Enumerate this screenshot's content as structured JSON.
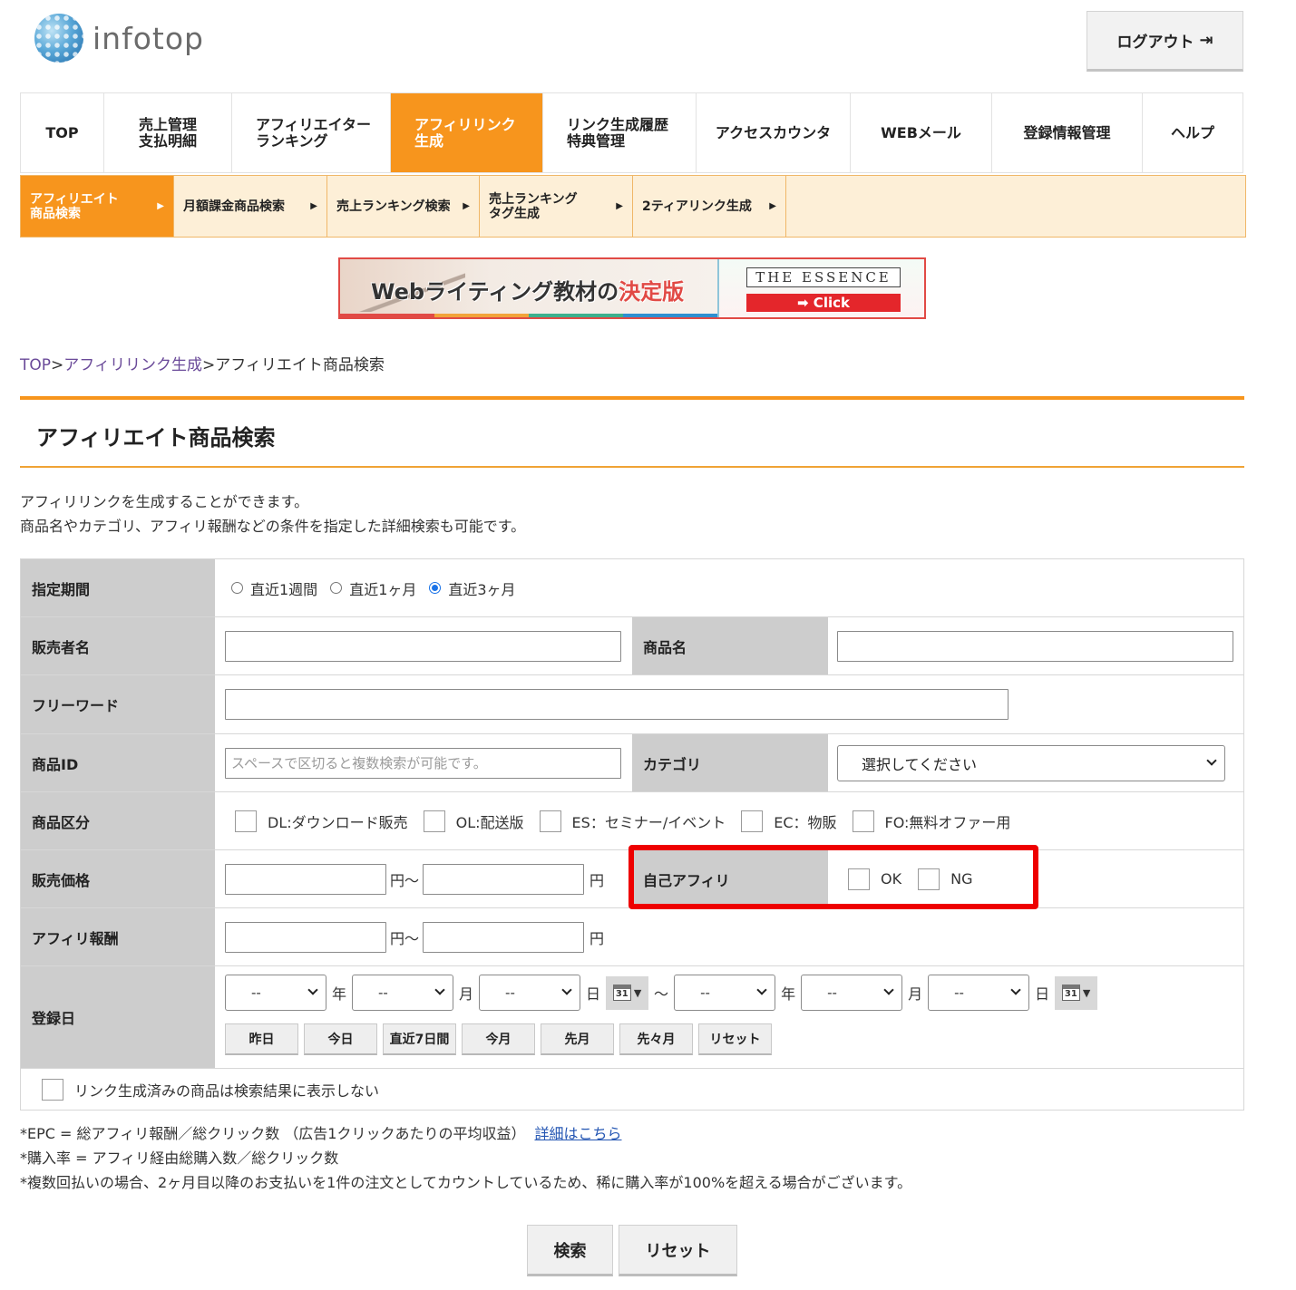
{
  "header": {
    "logo_text": "infotop",
    "logout_label": "ログアウト"
  },
  "main_nav": [
    {
      "label": "TOP"
    },
    {
      "label": "売上管理\n支払明細"
    },
    {
      "label": "アフィリエイター\nランキング"
    },
    {
      "label": "アフィリリンク\n生成",
      "active": true
    },
    {
      "label": "リンク生成履歴\n特典管理"
    },
    {
      "label": "アクセスカウンタ"
    },
    {
      "label": "WEBメール"
    },
    {
      "label": "登録情報管理"
    },
    {
      "label": "ヘルプ"
    }
  ],
  "sub_nav": [
    {
      "label": "アフィリエイト\n商品検索",
      "active": true
    },
    {
      "label": "月額課金商品検索"
    },
    {
      "label": "売上ランキング検索"
    },
    {
      "label": "売上ランキング\nタグ生成"
    },
    {
      "label": "2ティアリンク生成"
    }
  ],
  "banner": {
    "text_main": "Webライティング教材の",
    "text_highlight": "決定版",
    "brand": "THE ESSENCE",
    "cta": "➡ Click"
  },
  "breadcrumb": {
    "top": "TOP",
    "sep": ">",
    "level1": "アフィリリンク生成",
    "current": "アフィリエイト商品検索"
  },
  "page": {
    "title": "アフィリエイト商品検索",
    "intro_line1": "アフィリリンクを生成することができます。",
    "intro_line2": "商品名やカテゴリ、アフィリ報酬などの条件を指定した詳細検索も可能です。"
  },
  "form": {
    "period": {
      "label": "指定期間",
      "options": [
        "直近1週間",
        "直近1ヶ月",
        "直近3ヶ月"
      ],
      "selected": "直近3ヶ月"
    },
    "seller": {
      "label": "販売者名",
      "value": ""
    },
    "product_name": {
      "label": "商品名",
      "value": ""
    },
    "free_word": {
      "label": "フリーワード",
      "value": ""
    },
    "product_id": {
      "label": "商品ID",
      "placeholder": "スペースで区切ると複数検索が可能です。"
    },
    "category": {
      "label": "カテゴリ",
      "selected": "選択してください"
    },
    "product_type": {
      "label": "商品区分",
      "options": [
        "DL:ダウンロード販売",
        "OL:配送版",
        "ES：セミナー/イベント",
        "EC：物販",
        "FO:無料オファー用"
      ]
    },
    "price": {
      "label": "販売価格",
      "from_unit": "円〜",
      "to_unit": "円"
    },
    "self_affiliate": {
      "label": "自己アフィリ",
      "options": [
        "OK",
        "NG"
      ]
    },
    "reward": {
      "label": "アフィリ報酬",
      "from_unit": "円〜",
      "to_unit": "円"
    },
    "reg_date": {
      "label": "登録日",
      "placeholder": "--",
      "year": "年",
      "month": "月",
      "day": "日",
      "tilde": "〜",
      "cal_day": "31",
      "quick_buttons": [
        "昨日",
        "今日",
        "直近7日間",
        "今月",
        "先月",
        "先々月",
        "リセット"
      ]
    },
    "hide_generated": "リンク生成済みの商品は検索結果に表示しない"
  },
  "notes": {
    "epc": "*EPC = 総アフィリ報酬／総クリック数 （広告1クリックあたりの平均収益）",
    "epc_link": "詳細はこちら",
    "purchase_rate": "*購入率 = アフィリ経由総購入数／総クリック数",
    "multi_payment": "*複数回払いの場合、2ヶ月目以降のお支払いを1件の注文としてカウントしているため、稀に購入率が100%を超える場合がございます。"
  },
  "actions": {
    "search": "検索",
    "reset": "リセット"
  },
  "colors": {
    "accent": "#f7951d",
    "subnav_bg": "#fdefd7",
    "highlight": "#ee0000",
    "label_bg": "#cdcdcd"
  }
}
